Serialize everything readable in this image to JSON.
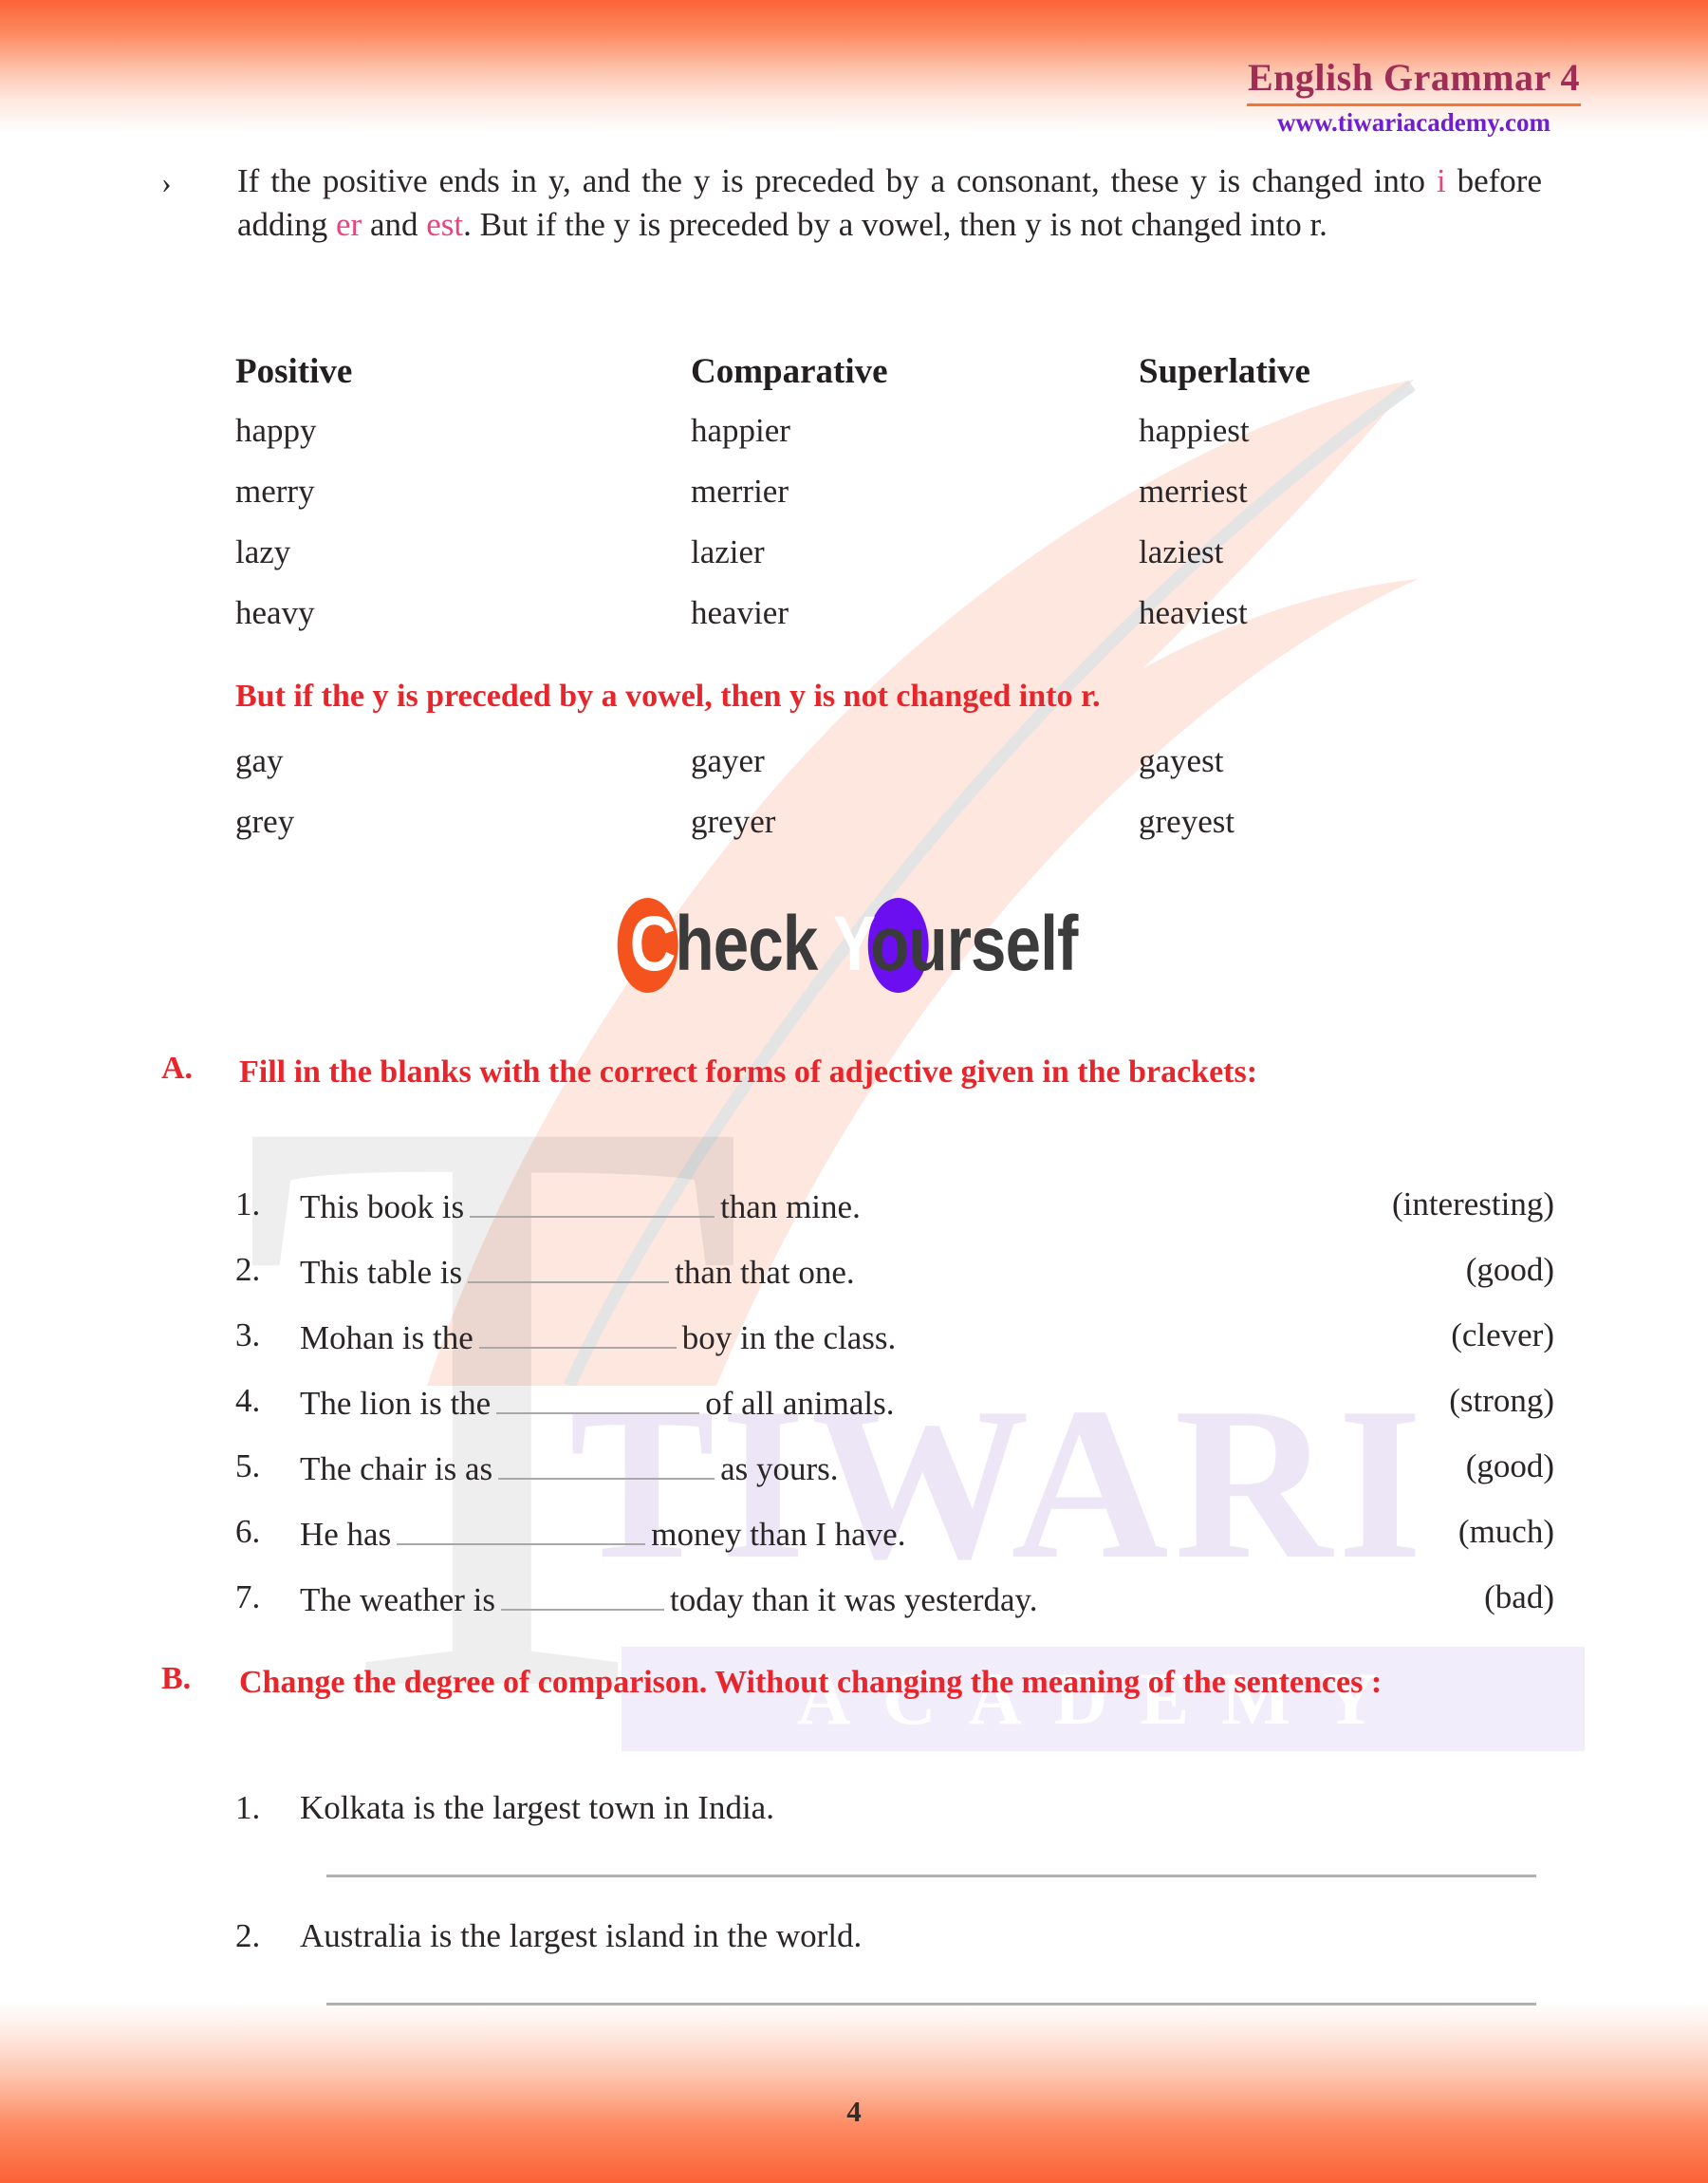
{
  "header": {
    "book_title": "English Grammar 4",
    "website": "www.tiwariacademy.com",
    "title_color": "#9e2e56",
    "url_color": "#6f1fd0",
    "rule_color": "#f4762f"
  },
  "intro": {
    "bullet": "›",
    "part1": "If the positive ends in y, and the y is preceded by a consonant, these y is changed into ",
    "hl1": "i",
    "part2": " before adding ",
    "hl2": "er",
    "part3": " and ",
    "hl3": "est",
    "part4": ". But if the y is preceded by a vowel, then y is not changed into r.",
    "highlight_color": "#e8447f"
  },
  "table1": {
    "headers": [
      "Positive",
      "Comparative",
      "Superlative"
    ],
    "rows": [
      [
        "happy",
        "happier",
        "happiest"
      ],
      [
        "merry",
        "merrier",
        "merriest"
      ],
      [
        "lazy",
        "lazier",
        "laziest"
      ],
      [
        "heavy",
        "heavier",
        "heaviest"
      ]
    ]
  },
  "note": {
    "text": "But if the y is preceded by a vowel, then y is not changed into r.",
    "color": "#e8252a"
  },
  "table2": {
    "rows": [
      [
        "gay",
        "gayer",
        "gayest"
      ],
      [
        "grey",
        "greyer",
        "greyest"
      ]
    ]
  },
  "check_yourself": {
    "c_letter": "C",
    "check_rest": "heck ",
    "y_letter": "Y",
    "yourself_rest": "ourself",
    "c_blob_color": "#f4531d",
    "y_blob_color": "#6b0ef0",
    "text_color": "#3b3b3b"
  },
  "section_a": {
    "letter": "A.",
    "heading": "Fill in the blanks with the correct forms of adjective given in the brackets:",
    "items": [
      {
        "num": "1.",
        "before": "This book is",
        "after": "than mine.",
        "hint": "(interesting)",
        "blank_width": 258
      },
      {
        "num": "2.",
        "before": "This table is",
        "after": "than that one.",
        "hint": "(good)",
        "blank_width": 212
      },
      {
        "num": "3.",
        "before": "Mohan is the",
        "after": "boy in the class.",
        "hint": "(clever)",
        "blank_width": 208
      },
      {
        "num": "4.",
        "before": "The lion is the",
        "after": "of all animals.",
        "hint": "(strong)",
        "blank_width": 214
      },
      {
        "num": "5.",
        "before": "The chair is as",
        "after": "as yours.",
        "hint": "(good)",
        "blank_width": 228
      },
      {
        "num": "6.",
        "before": "He has",
        "after": "money than I have.",
        "hint": "(much)",
        "blank_width": 262
      },
      {
        "num": "7.",
        "before": "The weather is",
        "after": "today than it was yesterday.",
        "hint": "(bad)",
        "blank_width": 172
      }
    ]
  },
  "section_b": {
    "letter": "B.",
    "heading": "Change the degree of comparison. Without changing the meaning of the sentences :",
    "items": [
      {
        "num": "1.",
        "text": "Kolkata is the largest town in India."
      },
      {
        "num": "2.",
        "text": "Australia is the largest island in the world."
      }
    ]
  },
  "watermarks": {
    "letter": "T",
    "tiwari": "TIWARI",
    "academy": "ACADEMY"
  },
  "footer": {
    "page_number": "4"
  }
}
